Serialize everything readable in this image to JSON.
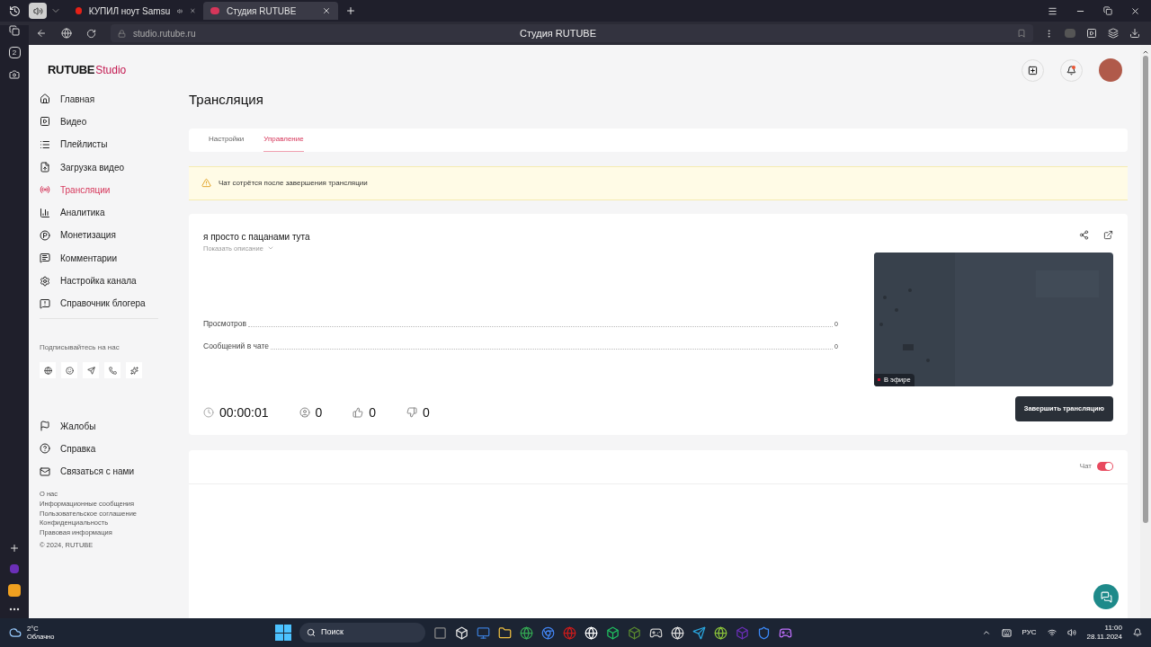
{
  "browser": {
    "tabs": [
      {
        "label": "КУПИЛ ноут Samsu",
        "selected": false,
        "audio": true
      },
      {
        "label": "Студия RUTUBE",
        "selected": true,
        "audio": false
      }
    ],
    "address": "studio.rutube.ru",
    "page_title": "Студия RUTUBE",
    "side_badge": "2"
  },
  "logo": {
    "brand": "RUTUBE",
    "product": "Studio"
  },
  "sidebar": {
    "nav": [
      {
        "label": "Главная",
        "selected": false
      },
      {
        "label": "Видео",
        "selected": false
      },
      {
        "label": "Плейлисты",
        "selected": false
      },
      {
        "label": "Загрузка видео",
        "selected": false
      },
      {
        "label": "Трансляции",
        "selected": true
      },
      {
        "label": "Аналитика",
        "selected": false
      },
      {
        "label": "Монетизация",
        "selected": false
      },
      {
        "label": "Комментарии",
        "selected": false
      },
      {
        "label": "Настройка канала",
        "selected": false
      },
      {
        "label": "Справочник блогера",
        "selected": false
      }
    ],
    "social_heading": "Подписывайтесь на нас",
    "support": [
      "Жалобы",
      "Справка",
      "Связаться с нами"
    ],
    "footer_links": [
      "О нас",
      "Информационные сообщения",
      "Пользовательское соглашение",
      "Конфиденциальность",
      "Правовая информация"
    ],
    "copyright": "© 2024, RUTUBE"
  },
  "page": {
    "title": "Трансляция",
    "tabs": [
      {
        "label": "Настройки",
        "selected": false
      },
      {
        "label": "Управление",
        "selected": true
      }
    ],
    "alert": "Чат сотрётся после завершения трансляции",
    "stream": {
      "title": "я просто с пацанами тута",
      "show_description": "Показать описание",
      "stats": [
        {
          "label": "Просмотров",
          "value": "0"
        },
        {
          "label": "Сообщений в чате",
          "value": "0"
        }
      ],
      "timer": "00:00:01",
      "viewers": "0",
      "likes": "0",
      "dislikes": "0",
      "live_badge": "В эфире",
      "end_button": "Завершить трансляцию"
    },
    "chat": {
      "label": "Чат",
      "on": true
    }
  },
  "taskbar": {
    "weather_temp": "2°C",
    "weather_text": "Облачно",
    "search_placeholder": "Поиск",
    "language": "РУС",
    "time": "11:00",
    "date": "28.11.2024"
  }
}
